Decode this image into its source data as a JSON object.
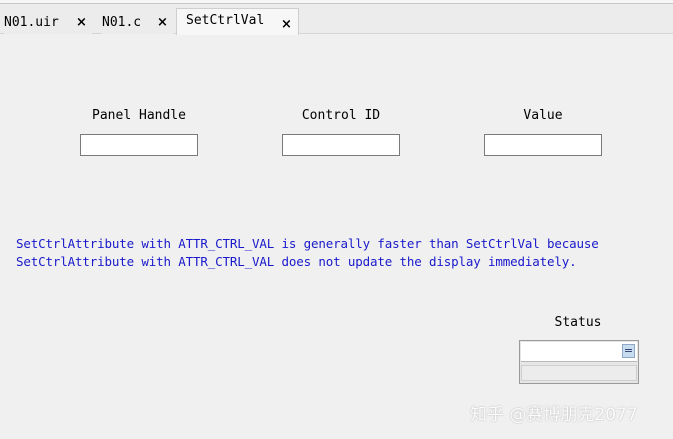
{
  "tabs": [
    {
      "label": "N01.uir",
      "close": "×"
    },
    {
      "label": "N01.c",
      "close": "×"
    },
    {
      "label": "SetCtrlVal",
      "close": "×",
      "active": true
    }
  ],
  "fields": {
    "panel_handle": {
      "label": "Panel Handle",
      "value": ""
    },
    "control_id": {
      "label": "Control ID",
      "value": ""
    },
    "value": {
      "label": "Value",
      "value": ""
    }
  },
  "note": {
    "line1": "SetCtrlAttribute with ATTR_CTRL_VAL is generally faster than SetCtrlVal because",
    "line2": "SetCtrlAttribute with ATTR_CTRL_VAL does not update the display immediately."
  },
  "status": {
    "label": "Status",
    "value": "",
    "eq_symbol": "="
  },
  "watermark": "知乎 @赛博朋克2077",
  "colors": {
    "note_text": "#1a1acc",
    "background": "#f0f0f0"
  }
}
